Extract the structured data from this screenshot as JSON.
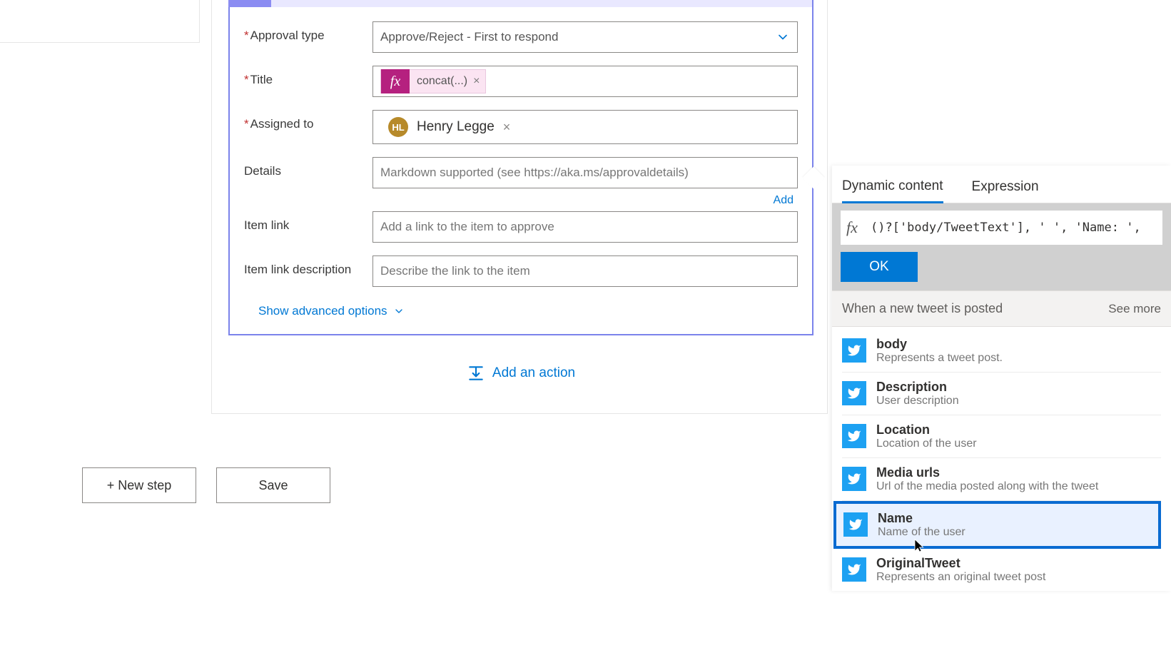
{
  "form": {
    "approval_type": {
      "label": "Approval type",
      "value": "Approve/Reject - First to respond"
    },
    "title": {
      "label": "Title",
      "chip_fx": "fx",
      "chip_text": "concat(...)"
    },
    "assigned_to": {
      "label": "Assigned to",
      "initials": "HL",
      "name": "Henry Legge"
    },
    "details": {
      "label": "Details",
      "placeholder": "Markdown supported (see https://aka.ms/approvaldetails)"
    },
    "add_dc": "Add",
    "item_link": {
      "label": "Item link",
      "placeholder": "Add a link to the item to approve"
    },
    "item_link_desc": {
      "label": "Item link description",
      "placeholder": "Describe the link to the item"
    },
    "advanced": "Show advanced options"
  },
  "add_action": "Add an action",
  "buttons": {
    "new_step": "+ New step",
    "save": "Save"
  },
  "popover": {
    "tabs": {
      "dynamic": "Dynamic content",
      "expression": "Expression"
    },
    "expr": "()?['body/TweetText'], ' ', 'Name: ', ",
    "ok": "OK",
    "section_title": "When a new tweet is posted",
    "see_more": "See more",
    "items": [
      {
        "t": "body",
        "d": "Represents a tweet post."
      },
      {
        "t": "Description",
        "d": "User description"
      },
      {
        "t": "Location",
        "d": "Location of the user"
      },
      {
        "t": "Media urls",
        "d": "Url of the media posted along with the tweet"
      },
      {
        "t": "Name",
        "d": "Name of the user"
      },
      {
        "t": "OriginalTweet",
        "d": "Represents an original tweet post"
      }
    ]
  }
}
